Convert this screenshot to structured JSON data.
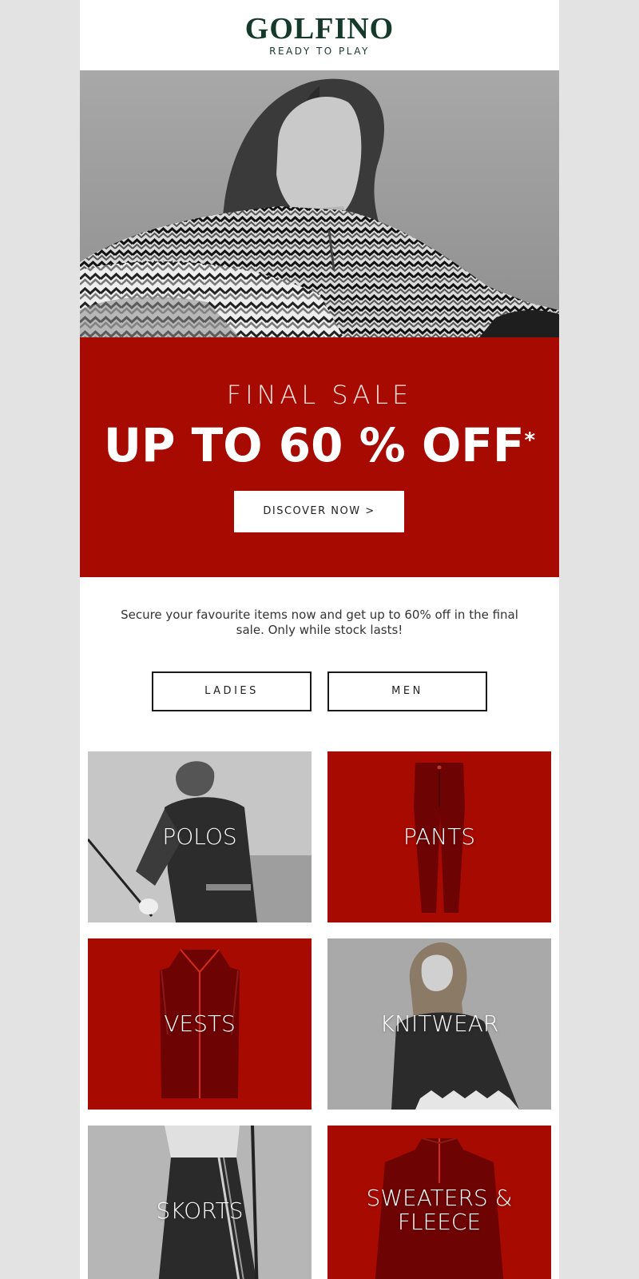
{
  "header": {
    "logo": "GOLFINO",
    "tagline": "READY TO PLAY"
  },
  "banner": {
    "top_line": "FINAL SALE",
    "headline": "UP TO 60 % OFF",
    "footnote_mark": "*",
    "cta": "DISCOVER NOW >"
  },
  "intro": {
    "text": "Secure your favourite items now and get up to 60% off in the final sale. Only while stock lasts!"
  },
  "gender": {
    "ladies": "LADIES",
    "men": "MEN"
  },
  "categories": [
    {
      "label": "POLOS"
    },
    {
      "label": "PANTS"
    },
    {
      "label": "VESTS"
    },
    {
      "label": "KNITWEAR"
    },
    {
      "label": "SKORTS"
    },
    {
      "label": "SWEATERS &",
      "label2": "FLEECE"
    }
  ],
  "colors": {
    "brand_green": "#153a2b",
    "sale_red": "#a60a00",
    "page_bg": "#e3e3e3"
  }
}
